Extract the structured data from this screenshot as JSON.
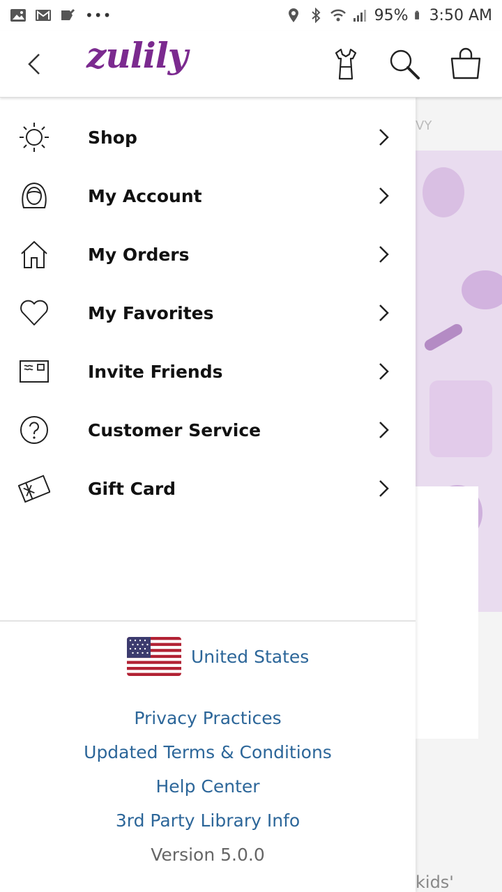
{
  "status_bar": {
    "battery": "95%",
    "time": "3:50 AM",
    "overflow": "•••"
  },
  "header": {
    "logo": "zulily"
  },
  "menu": [
    {
      "label": "Shop",
      "icon": "sun-icon"
    },
    {
      "label": "My Account",
      "icon": "person-icon"
    },
    {
      "label": "My Orders",
      "icon": "home-icon"
    },
    {
      "label": "My Favorites",
      "icon": "heart-icon"
    },
    {
      "label": "Invite Friends",
      "icon": "envelope-icon"
    },
    {
      "label": "Customer Service",
      "icon": "question-icon"
    },
    {
      "label": "Gift Card",
      "icon": "gift-card-icon"
    }
  ],
  "footer": {
    "country": "United States",
    "links": [
      "Privacy Practices",
      "Updated Terms & Conditions",
      "Help Center",
      "3rd Party Library Info"
    ],
    "version": "Version 5.0.0"
  },
  "background": {
    "tagline": "VY",
    "footer_text": "kids'"
  },
  "colors": {
    "brand": "#7b2a8f",
    "link": "#2c6699"
  }
}
